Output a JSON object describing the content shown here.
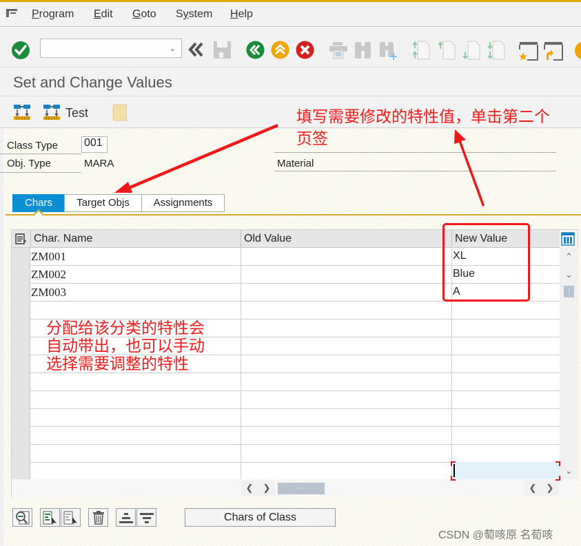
{
  "menubar": {
    "items": [
      {
        "label": "Program",
        "accel": "P"
      },
      {
        "label": "Edit",
        "accel": "E"
      },
      {
        "label": "Goto",
        "accel": "G"
      },
      {
        "label": "System",
        "accel": "y"
      },
      {
        "label": "Help",
        "accel": "H"
      }
    ]
  },
  "toolbar": {
    "command_field_value": "",
    "icons": [
      "enter-icon",
      "back-double-icon",
      "save-icon",
      "back-icon",
      "exit-icon",
      "cancel-icon",
      "print-icon",
      "find-icon",
      "find-next-icon",
      "first-page-icon",
      "previous-page-icon",
      "next-page-icon",
      "last-page-icon",
      "create-session-icon",
      "shortcut-icon"
    ]
  },
  "title": "Set and Change Values",
  "app_toolbar": {
    "test_label": "Test"
  },
  "header_fields": {
    "class_type_label": "Class Type",
    "class_type_value": "001",
    "obj_type_label": "Obj. Type",
    "obj_type_value": "MARA",
    "obj_type_desc": "Material"
  },
  "tabs": [
    {
      "label": "Chars",
      "active": true
    },
    {
      "label": "Target Objs",
      "active": false
    },
    {
      "label": "Assignments",
      "active": false
    }
  ],
  "grid": {
    "columns": [
      "Char. Name",
      "Old Value",
      "New Value"
    ],
    "rows": [
      {
        "char_name": "ZM001",
        "old_value": "",
        "new_value": "XL"
      },
      {
        "char_name": "ZM002",
        "old_value": "",
        "new_value": "Blue"
      },
      {
        "char_name": "ZM003",
        "old_value": "",
        "new_value": "A"
      },
      {
        "char_name": "",
        "old_value": "",
        "new_value": ""
      },
      {
        "char_name": "",
        "old_value": "",
        "new_value": ""
      },
      {
        "char_name": "",
        "old_value": "",
        "new_value": ""
      },
      {
        "char_name": "",
        "old_value": "",
        "new_value": ""
      },
      {
        "char_name": "",
        "old_value": "",
        "new_value": ""
      },
      {
        "char_name": "",
        "old_value": "",
        "new_value": ""
      },
      {
        "char_name": "",
        "old_value": "",
        "new_value": ""
      },
      {
        "char_name": "",
        "old_value": "",
        "new_value": ""
      },
      {
        "char_name": "",
        "old_value": "",
        "new_value": ""
      },
      {
        "char_name": "",
        "old_value": "",
        "new_value": ""
      }
    ]
  },
  "bottom_toolbar": {
    "icons": [
      "details-icon",
      "select-all-icon",
      "deselect-all-icon",
      "delete-icon",
      "sort-ascending-icon",
      "sort-descending-icon"
    ],
    "chars_of_class_label": "Chars of Class"
  },
  "annotations": {
    "top_right": "填写需要修改的特性值，单击第二个页签",
    "top_right_line1": "填写需要修改的特性值，单击第二个",
    "top_right_line2": "页签",
    "grid_note_line1": "分配给该分类的特性会",
    "grid_note_line2": "自动带出，也可以手动",
    "grid_note_line3": "选择需要调整的特性"
  },
  "watermark": "CSDN @萄咳原 名荀咳",
  "colors": {
    "accent_gold": "#e2a900",
    "tab_active": "#0a8fd4",
    "annotation_red": "#f21c1c",
    "enter_green": "#1b8a3a",
    "cancel_red": "#d42020",
    "exit_orange": "#f0a500"
  }
}
